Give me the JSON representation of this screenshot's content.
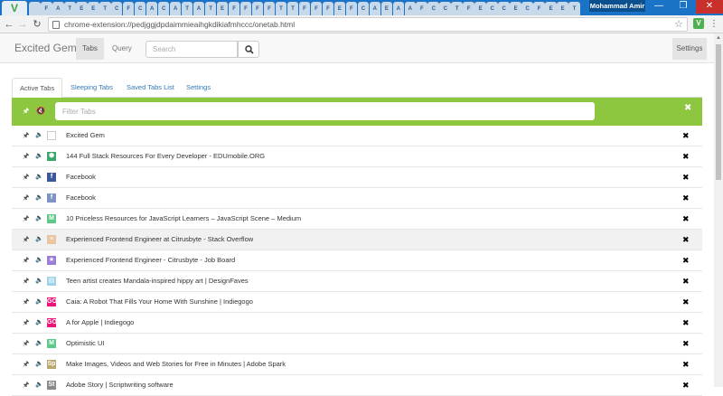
{
  "browser": {
    "profile_name": "Mohammad Amir",
    "url": "chrome-extension://pedjggjdpdaimmieaihgkdikiafmhccc/onetab.html",
    "mini_tab_letters": [
      "",
      "F",
      "A",
      "T",
      "E",
      "E",
      "T",
      "C",
      "F",
      "C",
      "A",
      "C",
      "A",
      "T",
      "A",
      "T",
      "E",
      "F",
      "F",
      "F",
      "F",
      "T",
      "T",
      "F",
      "F",
      "F",
      "E",
      "F",
      "C",
      "A",
      "E",
      "A",
      "A",
      "F",
      "C",
      "C",
      "T",
      "F",
      "E",
      "C",
      "C",
      "E",
      "C",
      "F",
      "E",
      "E",
      "T"
    ]
  },
  "navbar": {
    "brand": "Excited Gem",
    "tabs_label": "Tabs",
    "query_label": "Query",
    "search_placeholder": "Search",
    "settings_label": "Settings"
  },
  "content_tabs": {
    "active": "Active Tabs",
    "sleeping": "Sleeping Tabs",
    "saved": "Saved Tabs List",
    "settings": "Settings"
  },
  "filter": {
    "placeholder": "Filter Tabs"
  },
  "tabs": [
    {
      "title": "Excited Gem",
      "favicon": "blank-page-icon",
      "fav_color": "",
      "fav_char": "",
      "pinned": true
    },
    {
      "title": "144 Full Stack Resources For Every Developer - EDUmobile.ORG",
      "favicon": "edumobile-icon",
      "fav_color": "#3aa86b",
      "fav_char": "⬢",
      "pinned": true
    },
    {
      "title": "Facebook",
      "favicon": "facebook-icon",
      "fav_color": "#3b5998",
      "fav_char": "f",
      "pinned": false
    },
    {
      "title": "Facebook",
      "favicon": "facebook-icon",
      "fav_color": "#7c93c3",
      "fav_char": "f",
      "pinned": false
    },
    {
      "title": "10 Priceless Resources for JavaScript Learners – JavaScript Scene – Medium",
      "favicon": "medium-icon",
      "fav_color": "#5fc98a",
      "fav_char": "M",
      "pinned": false
    },
    {
      "title": "Experienced Frontend Engineer at Citrusbyte - Stack Overflow",
      "favicon": "stackoverflow-icon",
      "fav_color": "#e8c7a0",
      "fav_char": "≡",
      "pinned": false
    },
    {
      "title": "Experienced Frontend Engineer - Citrusbyte - Job Board",
      "favicon": "star-icon",
      "fav_color": "#9b7fd4",
      "fav_char": "★",
      "pinned": false
    },
    {
      "title": "Teen artist creates Mandala-inspired hippy art | DesignFaves",
      "favicon": "page-icon",
      "fav_color": "#9fd3e8",
      "fav_char": "▤",
      "pinned": false
    },
    {
      "title": "Caia: A Robot That Fills Your Home With Sunshine | Indiegogo",
      "favicon": "indiegogo-icon",
      "fav_color": "#eb1478",
      "fav_char": "GO",
      "pinned": false
    },
    {
      "title": "A for Apple | Indiegogo",
      "favicon": "indiegogo-icon",
      "fav_color": "#eb1478",
      "fav_char": "GO",
      "pinned": false
    },
    {
      "title": "Optimistic UI",
      "favicon": "medium-icon",
      "fav_color": "#5fc98a",
      "fav_char": "M",
      "pinned": false
    },
    {
      "title": "Make Images, Videos and Web Stories for Free in Minutes | Adobe Spark",
      "favicon": "adobe-spark-icon",
      "fav_color": "#b8a66a",
      "fav_char": "Sp",
      "pinned": false
    },
    {
      "title": "Adobe Story | Scriptwriting software",
      "favicon": "adobe-story-icon",
      "fav_color": "#8a8a8a",
      "fav_char": "St",
      "pinned": false
    }
  ],
  "hover_row_index": 5
}
